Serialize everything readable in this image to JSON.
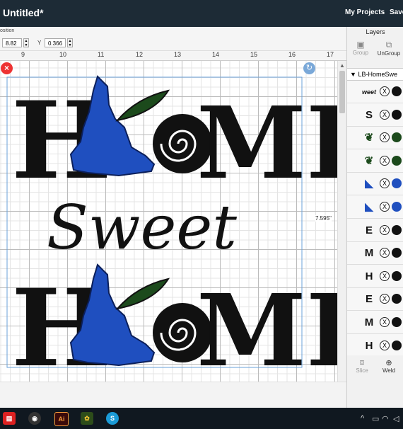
{
  "topbar": {
    "title": "Untitled*",
    "my_projects": "My Projects",
    "save": "Save"
  },
  "toolbar": {
    "position_label": "osition",
    "x_value": "8.82",
    "y_label": "Y",
    "y_value": "0.366"
  },
  "ruler": {
    "ticks": [
      "9",
      "10",
      "11",
      "12",
      "13",
      "14",
      "15",
      "16",
      "17"
    ]
  },
  "canvas": {
    "height_readout": "7.595\"",
    "design_text": {
      "home_h": "H",
      "home_me": "ME",
      "sweet": "Sweet"
    }
  },
  "layers_panel": {
    "title": "Layers",
    "group_label": "Group",
    "ungroup_label": "UnGroup",
    "group_name": "LB-HomeSwe",
    "slice_label": "Slice",
    "weld_label": "Weld",
    "items": [
      {
        "thumb": "weet",
        "color": "#111111"
      },
      {
        "thumb": "S",
        "color": "#111111"
      },
      {
        "thumb": "❦",
        "color": "#1c4a1c"
      },
      {
        "thumb": "❦",
        "color": "#1c4a1c"
      },
      {
        "thumb": "◣",
        "color": "#1f4fbf"
      },
      {
        "thumb": "◣",
        "color": "#1f4fbf"
      },
      {
        "thumb": "E",
        "color": "#111111"
      },
      {
        "thumb": "M",
        "color": "#111111"
      },
      {
        "thumb": "H",
        "color": "#111111"
      },
      {
        "thumb": "E",
        "color": "#111111"
      },
      {
        "thumb": "M",
        "color": "#111111"
      },
      {
        "thumb": "H",
        "color": "#111111"
      }
    ]
  },
  "colors": {
    "blue": "#1f4fbf",
    "green": "#1c4a1c",
    "black": "#111111",
    "topbar": "#1d2b36"
  }
}
